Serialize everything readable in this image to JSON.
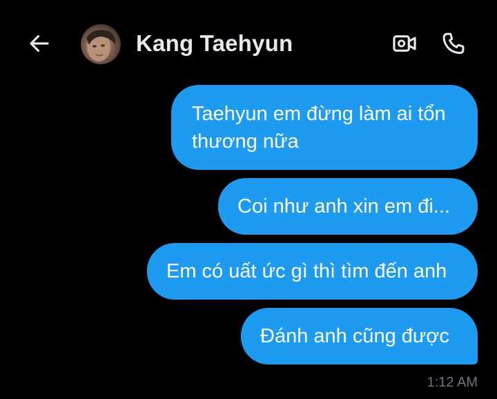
{
  "header": {
    "contact_name": "Kang Taehyun",
    "back_icon": "arrow-left-icon",
    "video_icon": "video-call-icon",
    "call_icon": "phone-icon",
    "avatar": "contact-avatar"
  },
  "messages": [
    {
      "text": "Taehyun em đừng làm ai tổn thương nữa",
      "sender": "me"
    },
    {
      "text": "Coi như anh xin em đi...",
      "sender": "me"
    },
    {
      "text": "Em có uất ức gì thì tìm đến anh",
      "sender": "me"
    },
    {
      "text": "Đánh anh cũng được",
      "sender": "me"
    }
  ],
  "timestamp": "1:12 AM",
  "colors": {
    "background": "#000000",
    "bubble": "#1d9bf0",
    "name_text": "#e7e9ea",
    "timestamp_text": "#71767b"
  }
}
